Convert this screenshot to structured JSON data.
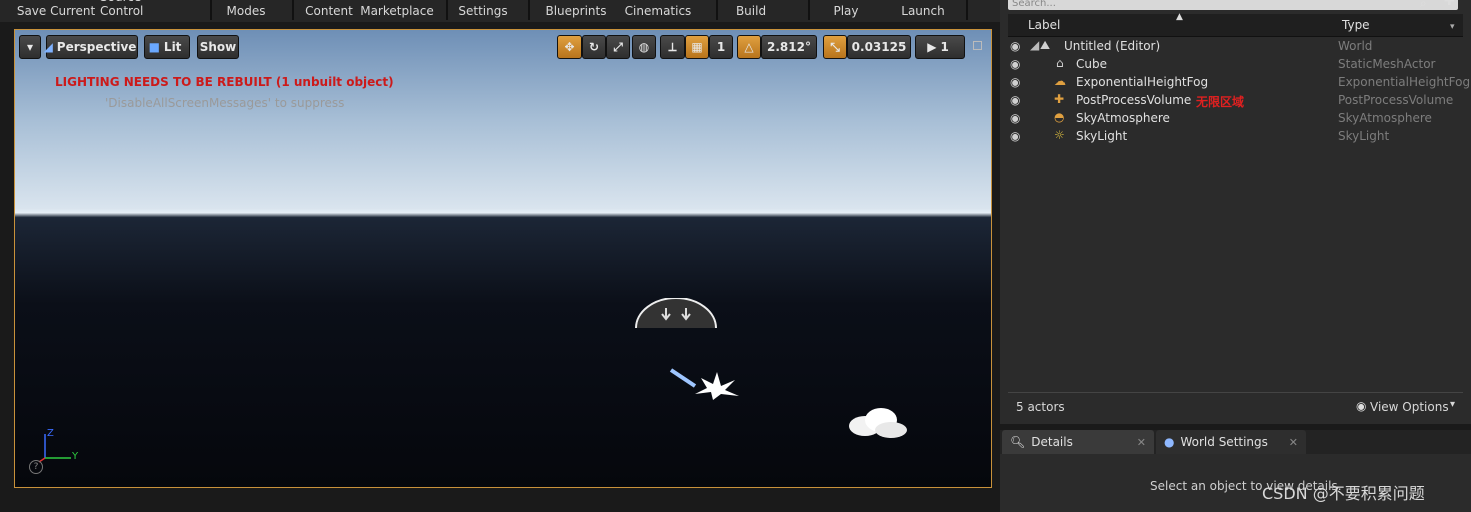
{
  "toolbar": {
    "items": [
      "Save Current",
      "Source Control",
      "Modes",
      "Content",
      "Marketplace",
      "Settings",
      "Blueprints",
      "Cinematics",
      "Build",
      "Play",
      "Launch"
    ]
  },
  "viewport": {
    "perspective_label": "Perspective",
    "lit_label": "Lit",
    "show_label": "Show",
    "grid_value": "1",
    "rotation_snap": "2.812°",
    "scale_snap": "0.03125",
    "camera_speed": "1",
    "lighting_warning": "LIGHTING NEEDS TO BE REBUILT (1 unbuilt object)",
    "suppress_hint": "'DisableAllScreenMessages' to suppress",
    "axis_z": "Z",
    "axis_y": "Y",
    "help_glyph": "?"
  },
  "outliner": {
    "search_placeholder": "Search...",
    "header_label": "Label",
    "header_type": "Type",
    "rows": [
      {
        "label": "Untitled (Editor)",
        "type": "World",
        "icon": "world-icon"
      },
      {
        "label": "Cube",
        "type": "StaticMeshActor",
        "icon": "static-mesh-icon"
      },
      {
        "label": "ExponentialHeightFog",
        "type": "ExponentialHeightFog",
        "icon": "fog-icon"
      },
      {
        "label": "PostProcessVolume",
        "type": "PostProcessVolume",
        "icon": "postprocess-icon"
      },
      {
        "label": "SkyAtmosphere",
        "type": "SkyAtmosphere",
        "icon": "sky-atmosphere-icon"
      },
      {
        "label": "SkyLight",
        "type": "SkyLight",
        "icon": "skylight-icon"
      }
    ],
    "annotation": "无限区域",
    "actor_count": "5 actors",
    "view_options": "View Options"
  },
  "details": {
    "tab_details": "Details",
    "tab_world_settings": "World Settings",
    "empty_message": "Select an object to view details."
  },
  "watermark": "CSDN @不要积累问题",
  "colors": {
    "viewport_border": "#c8913a",
    "warning_red": "#cc1a1a",
    "annotation_red": "#e02020",
    "orange_button": "#d08a30"
  }
}
